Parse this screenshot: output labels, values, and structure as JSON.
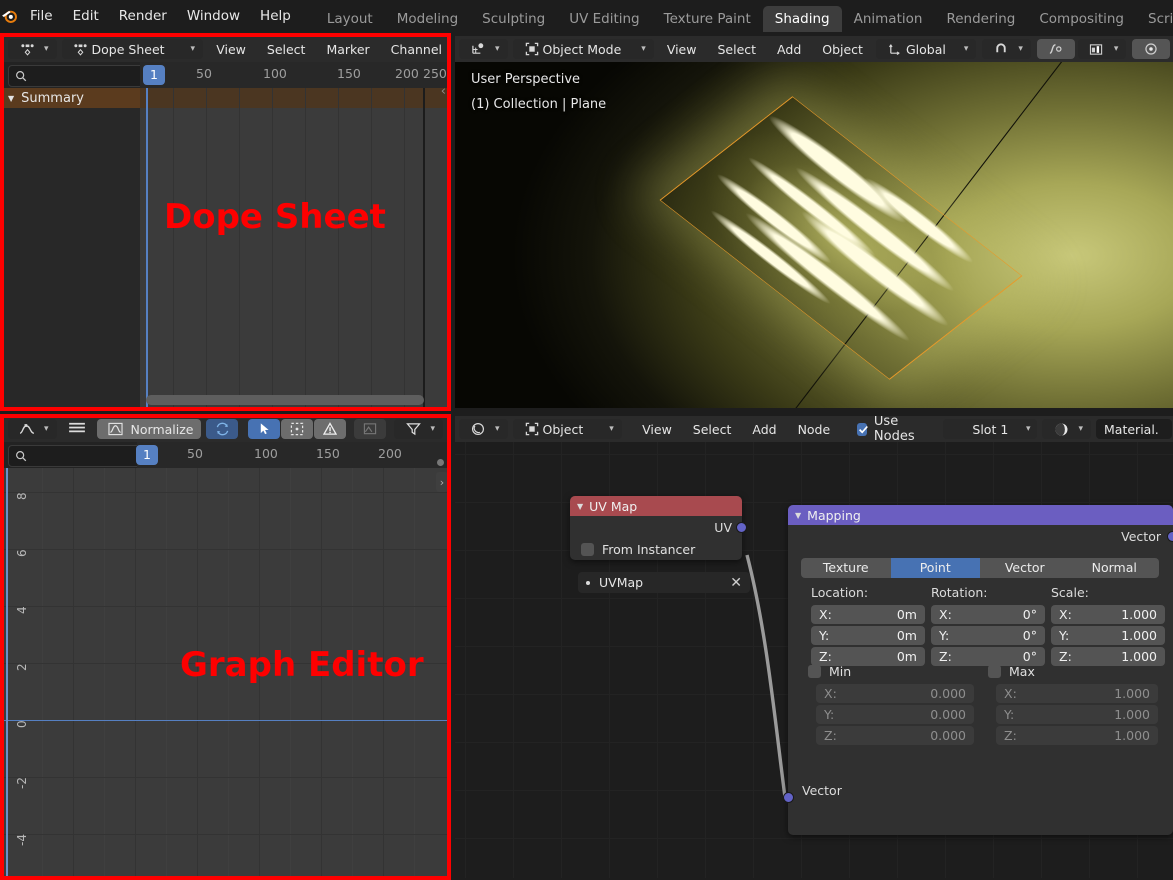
{
  "topbar": {
    "logo_icon": "blender-logo-icon",
    "menus": [
      "File",
      "Edit",
      "Render",
      "Window",
      "Help"
    ],
    "workspace_tabs": [
      {
        "label": "Layout",
        "active": false
      },
      {
        "label": "Modeling",
        "active": false
      },
      {
        "label": "Sculpting",
        "active": false
      },
      {
        "label": "UV Editing",
        "active": false
      },
      {
        "label": "Texture Paint",
        "active": false
      },
      {
        "label": "Shading",
        "active": true
      },
      {
        "label": "Animation",
        "active": false
      },
      {
        "label": "Rendering",
        "active": false
      },
      {
        "label": "Compositing",
        "active": false
      },
      {
        "label": "Scripting",
        "active": false
      }
    ]
  },
  "dope_sheet": {
    "editor_type_icon": "dope-sheet-editor-icon",
    "mode_icon": "dope-sheet-icon",
    "mode_label": "Dope Sheet",
    "menus": [
      "View",
      "Select",
      "Marker",
      "Channel"
    ],
    "search_placeholder": "",
    "search_icon": "search-icon",
    "channel_summary": "Summary",
    "summary_expand_icon": "triangle-down-icon",
    "current_frame": "1",
    "ruler_ticks": [
      "50",
      "100",
      "150",
      "200",
      "250"
    ],
    "annotation": "Dope Sheet"
  },
  "graph_editor": {
    "editor_type_icon": "graph-editor-icon",
    "menu_icon": "hamburger-menu-icon",
    "normalize_icon": "normalize-curve-icon",
    "normalize_label": "Normalize",
    "auto_refresh_icon": "refresh-icon",
    "cursor_icon": "pointer-select-icon",
    "handles_icon": "dashed-box-icon",
    "error_icon": "warning-triangle-icon",
    "ghost_icon": "ghost-curves-icon",
    "filter_icon": "filter-funnel-icon",
    "proportional_icon": "proportional-editing-icon",
    "search_placeholder": "",
    "search_icon": "search-icon",
    "current_frame": "1",
    "ruler_ticks": [
      "50",
      "100",
      "150",
      "200"
    ],
    "y_ticks": [
      "8",
      "6",
      "4",
      "2",
      "0",
      "-2",
      "-4"
    ],
    "annotation": "Graph Editor"
  },
  "viewport3d": {
    "editor_type_icon": "3d-viewport-editor-icon",
    "mode_icon": "object-mode-icon",
    "mode_label": "Object Mode",
    "menus": [
      "View",
      "Select",
      "Add",
      "Object"
    ],
    "orientation_icon": "transform-orientation-icon",
    "orientation_label": "Global",
    "snap_icon": "magnet-icon",
    "snap_dropdown_icon": "snapping-target-icon",
    "proportional_icon": "proportional-edit-icon",
    "proportional_falloff_icon": "falloff-curve-icon",
    "overlay_toggle_icon": "overlays-icon",
    "info_line_1": "User Perspective",
    "info_line_2": "(1) Collection | Plane",
    "cursor_icon": "3d-cursor-icon",
    "object_outline_color": "#e89a2a"
  },
  "shader_editor": {
    "editor_type_icon": "shader-editor-icon",
    "shader_type_icon": "object-shader-icon",
    "shader_type_label": "Object",
    "menus": [
      "View",
      "Select",
      "Add",
      "Node"
    ],
    "use_nodes_label": "Use Nodes",
    "use_nodes_checked": true,
    "slot_label": "Slot 1",
    "material_icon": "material-sphere-icon",
    "material_name": "Material.",
    "nodes": [
      {
        "id": "uv-map-node",
        "title": "UV Map",
        "header_color": "#a84a4f",
        "output_socket": "UV",
        "checkbox_label": "From Instancer",
        "checkbox_checked": false,
        "dropdown_value": "UVMap",
        "dropdown_icon": "uv-dot-icon",
        "clear_icon": "x-icon"
      },
      {
        "id": "mapping-node",
        "title": "Mapping",
        "header_color": "#6b5ec1",
        "output_socket": "Vector",
        "input_socket": "Vector",
        "type_tabs": [
          {
            "label": "Texture",
            "active": false
          },
          {
            "label": "Point",
            "active": true
          },
          {
            "label": "Vector",
            "active": false
          },
          {
            "label": "Normal",
            "active": false
          }
        ],
        "columns": [
          {
            "label": "Location:",
            "rows": [
              {
                "axis": "X:",
                "value": "0m"
              },
              {
                "axis": "Y:",
                "value": "0m"
              },
              {
                "axis": "Z:",
                "value": "0m"
              }
            ]
          },
          {
            "label": "Rotation:",
            "rows": [
              {
                "axis": "X:",
                "value": "0°"
              },
              {
                "axis": "Y:",
                "value": "0°"
              },
              {
                "axis": "Z:",
                "value": "0°"
              }
            ]
          },
          {
            "label": "Scale:",
            "rows": [
              {
                "axis": "X:",
                "value": "1.000"
              },
              {
                "axis": "Y:",
                "value": "1.000"
              },
              {
                "axis": "Z:",
                "value": "1.000"
              }
            ]
          }
        ],
        "minmax": [
          {
            "label": "Min",
            "checked": false,
            "rows": [
              {
                "axis": "X:",
                "value": "0.000"
              },
              {
                "axis": "Y:",
                "value": "0.000"
              },
              {
                "axis": "Z:",
                "value": "0.000"
              }
            ]
          },
          {
            "label": "Max",
            "checked": false,
            "rows": [
              {
                "axis": "X:",
                "value": "1.000"
              },
              {
                "axis": "Y:",
                "value": "1.000"
              },
              {
                "axis": "Z:",
                "value": "1.000"
              }
            ]
          }
        ]
      }
    ]
  },
  "annotations": {
    "color": "#fe0000",
    "boxes": [
      "Dope Sheet",
      "Graph Editor"
    ]
  }
}
